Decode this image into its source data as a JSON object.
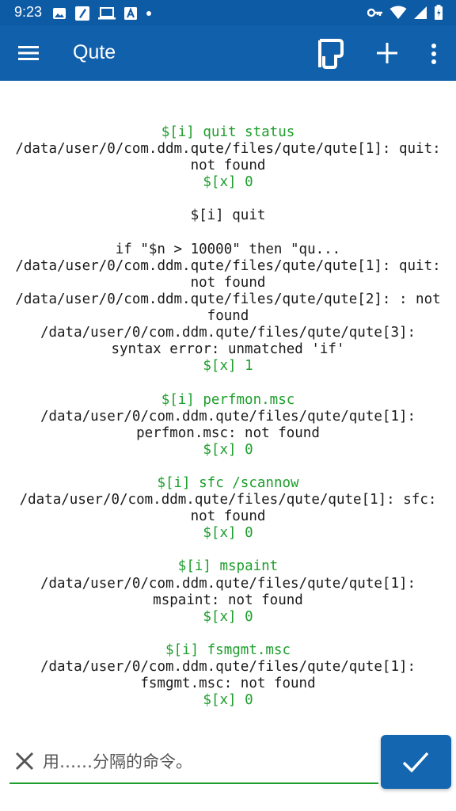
{
  "status_bar": {
    "time": "9:23",
    "left_icons": [
      "image-icon",
      "edit-note-icon",
      "laptop-icon",
      "font-icon",
      "dot-icon"
    ],
    "right_icons": [
      "vpn-key-icon",
      "wifi-icon",
      "cell-signal-icon",
      "battery-icon"
    ]
  },
  "app_bar": {
    "title": "Qute",
    "actions": [
      "wrap-text-icon",
      "add-icon",
      "more-vert-icon"
    ],
    "color": "#1160ab"
  },
  "output": {
    "accent_color": "#1e9e2c",
    "lines": [
      {
        "text": "$[i] quit status",
        "green": true,
        "cut": true
      },
      {
        "text": "/data/user/0/com.ddm.qute/files/qute/qute[1]: quit:",
        "green": false
      },
      {
        "text": "not found",
        "green": false
      },
      {
        "text": "$[x] 0",
        "green": true
      },
      {
        "text": "",
        "green": false
      },
      {
        "text": "$[i] quit",
        "green": false
      },
      {
        "text": "",
        "green": false
      },
      {
        "text": "if \"$n > 10000\" then \"qu...",
        "green": false
      },
      {
        "text": "/data/user/0/com.ddm.qute/files/qute/qute[1]: quit:",
        "green": false
      },
      {
        "text": "not found",
        "green": false
      },
      {
        "text": "/data/user/0/com.ddm.qute/files/qute/qute[2]: : not",
        "green": false
      },
      {
        "text": "found",
        "green": false
      },
      {
        "text": "/data/user/0/com.ddm.qute/files/qute/qute[3]:",
        "green": false
      },
      {
        "text": "syntax error: unmatched 'if'",
        "green": false
      },
      {
        "text": "$[x] 1",
        "green": true
      },
      {
        "text": "",
        "green": false
      },
      {
        "text": "$[i] perfmon.msc",
        "green": true
      },
      {
        "text": "/data/user/0/com.ddm.qute/files/qute/qute[1]:",
        "green": false
      },
      {
        "text": "perfmon.msc: not found",
        "green": false
      },
      {
        "text": "$[x] 0",
        "green": true
      },
      {
        "text": "",
        "green": false
      },
      {
        "text": "$[i] sfc /scannow",
        "green": true
      },
      {
        "text": "/data/user/0/com.ddm.qute/files/qute/qute[1]: sfc:",
        "green": false
      },
      {
        "text": "not found",
        "green": false
      },
      {
        "text": "$[x] 0",
        "green": true
      },
      {
        "text": "",
        "green": false
      },
      {
        "text": "$[i] mspaint",
        "green": true
      },
      {
        "text": "/data/user/0/com.ddm.qute/files/qute/qute[1]:",
        "green": false
      },
      {
        "text": "mspaint: not found",
        "green": false
      },
      {
        "text": "$[x] 0",
        "green": true
      },
      {
        "text": "",
        "green": false
      },
      {
        "text": "$[i] fsmgmt.msc",
        "green": true
      },
      {
        "text": "/data/user/0/com.ddm.qute/files/qute/qute[1]:",
        "green": false
      },
      {
        "text": "fsmgmt.msc: not found",
        "green": false
      },
      {
        "text": "$[x] 0",
        "green": true
      }
    ]
  },
  "input": {
    "placeholder": "用……分隔的命令。",
    "value": ""
  },
  "submit": {
    "icon": "check-icon",
    "color": "#1466b0"
  }
}
